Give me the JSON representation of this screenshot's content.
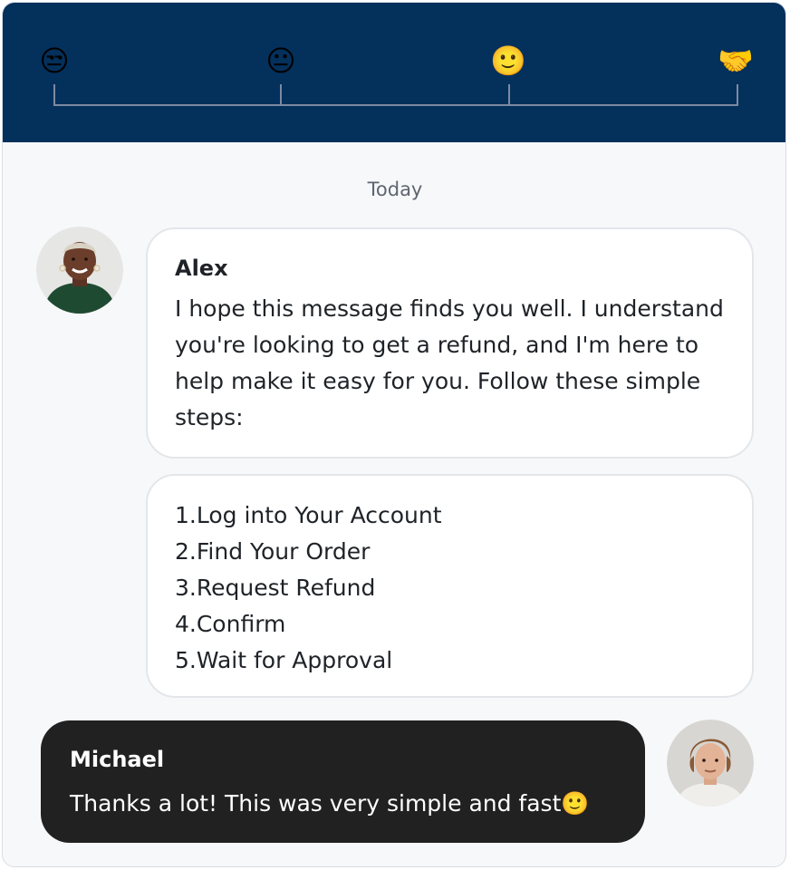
{
  "timeline": {
    "stages": [
      {
        "emoji": "😒",
        "name": "unamused-face-icon"
      },
      {
        "emoji": "😐",
        "name": "neutral-face-icon"
      },
      {
        "emoji": "🙂",
        "name": "slightly-smiling-face-icon"
      },
      {
        "emoji": "🤝",
        "name": "handshake-icon"
      }
    ],
    "colors": {
      "header_bg": "#04305c",
      "line": "#7d8aa0"
    }
  },
  "conversation": {
    "date_label": "Today",
    "messages": [
      {
        "sender": "Alex",
        "text": "I hope this message finds you well. I understand you're looking to get a refund, and I'm here to help make it easy for you. Follow these simple steps:",
        "steps": [
          "1.Log into Your Account",
          "2.Find Your Order",
          "3.Request Refund",
          "4.Confirm",
          "5.Wait for Approval"
        ]
      },
      {
        "sender": "Michael",
        "text": "Thanks a lot! This was very simple and fast🙂"
      }
    ]
  },
  "colors": {
    "outgoing_bubble": "#212121",
    "incoming_bubble": "#ffffff",
    "background": "#f7f8fa"
  }
}
